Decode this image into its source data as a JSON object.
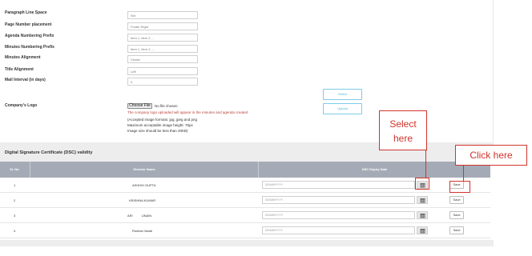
{
  "settings": {
    "paragraph_line_space": {
      "label": "Paragraph Line Space",
      "value": "Set"
    },
    "page_number_placement": {
      "label": "Page Number placement",
      "value": "Footer Right"
    },
    "agenda_numbering_prefix": {
      "label": "Agenda Numbering Prefix",
      "value": "Item 1, Item 2, ..."
    },
    "minutes_numbering_prefix": {
      "label": "Minutes Numbering Prefix",
      "value": "Item 1, Item 2, ..."
    },
    "minutes_alignment": {
      "label": "Minutes Alignment",
      "value": "Center"
    },
    "title_alignment": {
      "label": "Title Alignment",
      "value": "Left"
    },
    "mail_interval": {
      "label": "Mail Interval (in days)",
      "value": "0"
    },
    "select_button": "Select",
    "company_logo": {
      "label": "Company's Logo",
      "choose_file": "Choose File",
      "file_status": "No file chosen",
      "upload_button": "Upload",
      "note_red": "The company logo uploaded will appear in the minutes and agenda created",
      "note_formats": "(Accepted image formats: jpg, jpeg and png",
      "note_height": "Maximum acceptable image height: 75px",
      "note_size": "Image size should be less than 20KB)"
    }
  },
  "dsc": {
    "title": "Digital Signature Certificate (DSC) validity",
    "headers": {
      "sl_no": "Sl. No.",
      "director_name": "Director Name",
      "expiry_date": "DSC Expiry Date"
    },
    "date_placeholder": "DD/MM/YYYY",
    "save_label": "Save",
    "rows": [
      {
        "sl": "1",
        "name": "ASHISH GUPTA"
      },
      {
        "sl": "2",
        "name": "KRISHNA KUMAR"
      },
      {
        "sl": "3",
        "name": "ARI          UNAIN"
      },
      {
        "sl": "4",
        "name": "Roshan Vadal"
      }
    ]
  },
  "annotations": {
    "select_here": "Select here",
    "click_here": "Click here"
  },
  "colors": {
    "table_header": "#a5abb6",
    "annotation_red": "#d0342c",
    "upload_outline": "#7fcbe8",
    "note_red": "#b9453b"
  },
  "icons": {
    "calendar": "calendar-icon"
  }
}
